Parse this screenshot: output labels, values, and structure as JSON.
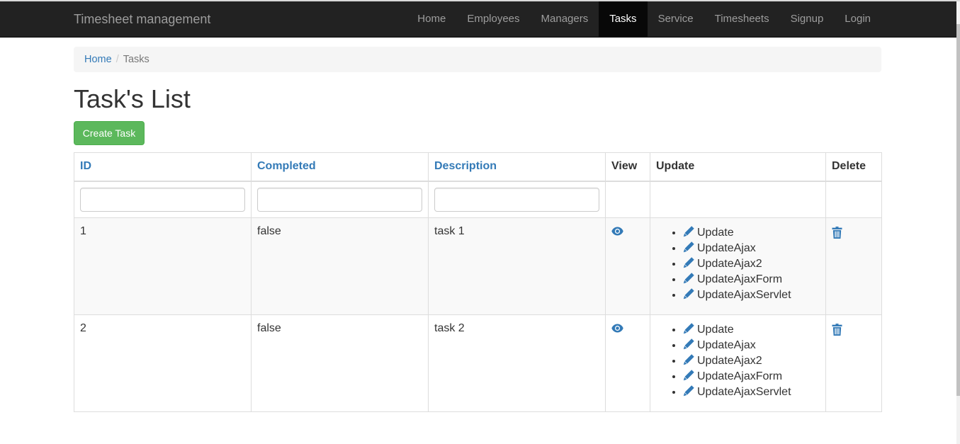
{
  "navbar": {
    "brand": "Timesheet management",
    "items": [
      {
        "label": "Home",
        "active": false
      },
      {
        "label": "Employees",
        "active": false
      },
      {
        "label": "Managers",
        "active": false
      },
      {
        "label": "Tasks",
        "active": true
      },
      {
        "label": "Service",
        "active": false
      },
      {
        "label": "Timesheets",
        "active": false
      },
      {
        "label": "Signup",
        "active": false
      },
      {
        "label": "Login",
        "active": false
      }
    ]
  },
  "breadcrumb": {
    "home": "Home",
    "separator": "/",
    "current": "Tasks"
  },
  "page": {
    "title": "Task's List",
    "create_button": "Create Task"
  },
  "table": {
    "headers": {
      "id": "ID",
      "completed": "Completed",
      "description": "Description",
      "view": "View",
      "update": "Update",
      "delete": "Delete"
    },
    "filters": {
      "id": "",
      "completed": "",
      "description": ""
    },
    "icons": {
      "view": "eye-icon",
      "update": "pencil-icon",
      "delete": "trash-icon"
    },
    "rows": [
      {
        "id": "1",
        "completed": "false",
        "description": "task 1",
        "update_links": [
          "Update",
          "UpdateAjax",
          "UpdateAjax2",
          "UpdateAjaxForm",
          "UpdateAjaxServlet"
        ]
      },
      {
        "id": "2",
        "completed": "false",
        "description": "task 2",
        "update_links": [
          "Update",
          "UpdateAjax",
          "UpdateAjax2",
          "UpdateAjaxForm",
          "UpdateAjaxServlet"
        ]
      }
    ]
  },
  "colors": {
    "navbar_bg": "#222222",
    "nav_active_bg": "#080808",
    "link": "#337ab7",
    "success": "#5cb85c",
    "breadcrumb_bg": "#f5f5f5"
  }
}
